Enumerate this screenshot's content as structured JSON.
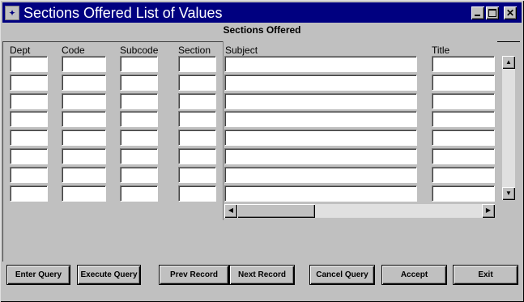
{
  "window": {
    "title": "Sections Offered List of Values",
    "icon_name": "oracle-forms-icon",
    "controls": [
      "minimize",
      "maximize",
      "close"
    ]
  },
  "frame": {
    "title": "Sections Offered"
  },
  "columns": {
    "dept": "Dept",
    "code": "Code",
    "subcode": "Subcode",
    "section": "Section",
    "subject": "Subject",
    "title": "Title"
  },
  "rows": [
    {
      "dept": "",
      "code": "",
      "subcode": "",
      "section": "",
      "subject": "",
      "title": ""
    },
    {
      "dept": "",
      "code": "",
      "subcode": "",
      "section": "",
      "subject": "",
      "title": ""
    },
    {
      "dept": "",
      "code": "",
      "subcode": "",
      "section": "",
      "subject": "",
      "title": ""
    },
    {
      "dept": "",
      "code": "",
      "subcode": "",
      "section": "",
      "subject": "",
      "title": ""
    },
    {
      "dept": "",
      "code": "",
      "subcode": "",
      "section": "",
      "subject": "",
      "title": ""
    },
    {
      "dept": "",
      "code": "",
      "subcode": "",
      "section": "",
      "subject": "",
      "title": ""
    },
    {
      "dept": "",
      "code": "",
      "subcode": "",
      "section": "",
      "subject": "",
      "title": ""
    },
    {
      "dept": "",
      "code": "",
      "subcode": "",
      "section": "",
      "subject": "",
      "title": ""
    }
  ],
  "buttons": {
    "enter_query": "Enter Query",
    "execute_query": "Execute Query",
    "prev_record": "Prev Record",
    "next_record": "Next Record",
    "cancel_query": "Cancel Query",
    "accept": "Accept",
    "exit": "Exit"
  },
  "colors": {
    "titlebar": "#000080",
    "face": "#c0c0c0",
    "field": "#ffffff"
  }
}
